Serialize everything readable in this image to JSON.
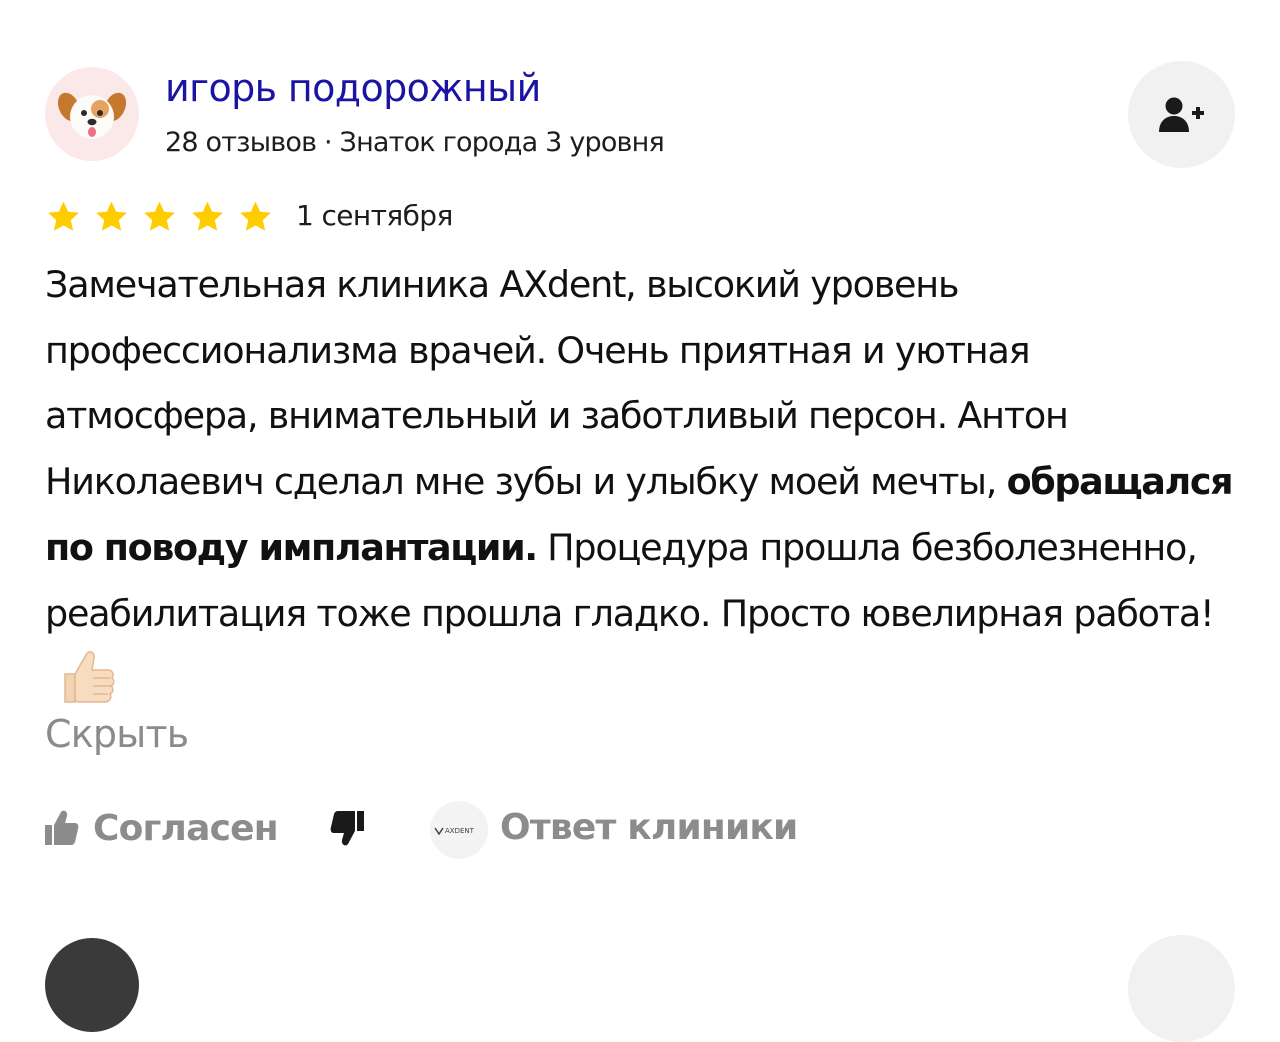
{
  "author": {
    "name": "игорь подорожный",
    "meta": "28 отзывов · Знаток города 3 уровня",
    "avatar_icon": "puppy-emoji-avatar"
  },
  "subscribe_icon": "add-person-icon",
  "rating": {
    "stars": 5,
    "max": 5,
    "color": "#ffcc00"
  },
  "date": "1 сентября",
  "review": {
    "part1": "Замечательная клиника AXdent, высокий уровень профессионализма врачей. Очень приятная и уютная атмосфера, внимательный и заботливый персон. Антон Николаевич сделал мне зубы и улыбку моей мечты, ",
    "bold": "обращался по поводу имплантации.",
    "part2": " Процедура прошла безболезненно, реабилитация тоже прошла гладко. Просто ювелирная работа!",
    "emoji": "thumbs-up-emoji"
  },
  "hide_label": "Скрыть",
  "actions": {
    "like_label": "Согласен",
    "like_icon": "thumbs-up-icon",
    "dislike_icon": "thumbs-down-icon",
    "clinic_logo_text": "AXDENT",
    "clinic_reply_label": "Ответ клиники"
  },
  "colors": {
    "author_name": "#1a14a3",
    "muted": "#8c8c8c",
    "star": "#ffcc00",
    "button_bg": "#f1f1f1"
  }
}
